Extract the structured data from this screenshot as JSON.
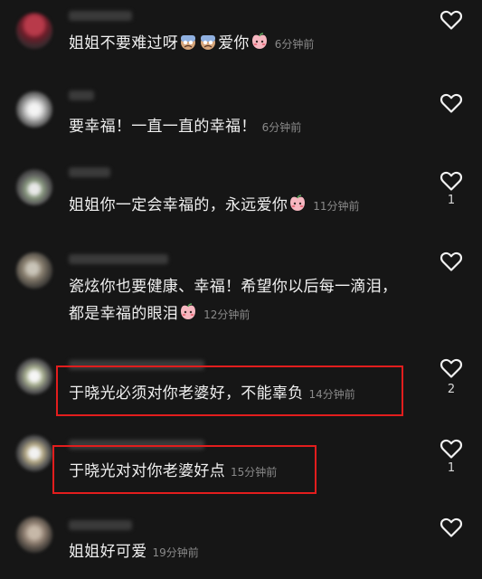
{
  "comments": [
    {
      "text_parts": [
        "姐姐不要难过呀",
        "爱你"
      ],
      "time": "6分钟前",
      "likes": "",
      "emoji": [
        "worried-face-emoji",
        "worried-face-emoji",
        "peach-face-emoji"
      ]
    },
    {
      "text": "要幸福！一直一直的幸福！",
      "time": "6分钟前",
      "likes": ""
    },
    {
      "text": "姐姐你一定会幸福的，永远爱你",
      "time": "11分钟前",
      "likes": "1",
      "emoji": [
        "peach-face-emoji"
      ]
    },
    {
      "text_line1": "瓷炫你也要健康、幸福！希望你以后每一滴泪，",
      "text_line2": "都是幸福的眼泪",
      "time": "12分钟前",
      "likes": "",
      "emoji": [
        "peach-face-emoji"
      ]
    },
    {
      "text": "于晓光必须对你老婆好，不能辜负",
      "time": "14分钟前",
      "likes": "2",
      "highlighted": true
    },
    {
      "text": "于晓光对对你老婆好点",
      "time": "15分钟前",
      "likes": "1",
      "highlighted": true
    },
    {
      "text": "姐姐好可爱",
      "time": "19分钟前",
      "likes": ""
    }
  ],
  "colors": {
    "background": "#161616",
    "highlight": "#e21d1d",
    "time": "#8a8a8a"
  },
  "icons": [
    "heart-outline-icon"
  ]
}
